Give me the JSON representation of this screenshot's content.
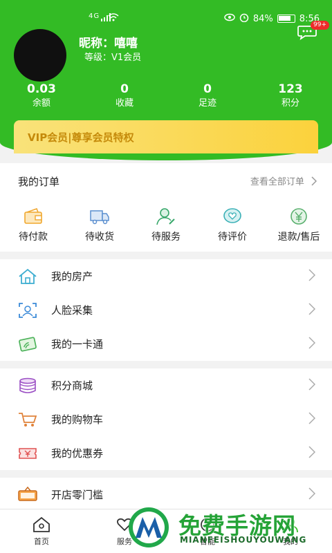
{
  "status_bar": {
    "network": "4G",
    "battery": "84%",
    "time": "8:56"
  },
  "profile": {
    "nickname": "昵称：嘻嘻",
    "level": "等级：V1会员",
    "message_badge": "99+"
  },
  "stats": [
    {
      "value": "0.03",
      "label": "余额"
    },
    {
      "value": "0",
      "label": "收藏"
    },
    {
      "value": "0",
      "label": "足迹"
    },
    {
      "value": "123",
      "label": "积分"
    }
  ],
  "vip_banner": "VIP会员|尊享会员特权",
  "orders": {
    "title": "我的订单",
    "view_all": "查看全部订单",
    "items": [
      {
        "label": "待付款",
        "icon": "wallet-icon"
      },
      {
        "label": "待收货",
        "icon": "truck-icon"
      },
      {
        "label": "待服务",
        "icon": "service-person-icon"
      },
      {
        "label": "待评价",
        "icon": "heart-chat-icon"
      },
      {
        "label": "退款/售后",
        "icon": "yen-refund-icon"
      }
    ]
  },
  "menu_group_1": [
    {
      "label": "我的房产",
      "icon": "house-icon"
    },
    {
      "label": "人脸采集",
      "icon": "face-scan-icon"
    },
    {
      "label": "我的一卡通",
      "icon": "card-icon"
    }
  ],
  "menu_group_2": [
    {
      "label": "积分商城",
      "icon": "coins-stack-icon"
    },
    {
      "label": "我的购物车",
      "icon": "cart-icon"
    },
    {
      "label": "我的优惠券",
      "icon": "coupon-icon"
    }
  ],
  "menu_group_3": [
    {
      "label": "开店零门槛",
      "icon": "open-sign-icon"
    }
  ],
  "tabbar": [
    {
      "label": "首页",
      "icon": "home-icon"
    },
    {
      "label": "服务",
      "icon": "heart-hand-icon"
    },
    {
      "label": "智能",
      "icon": "smart-icon"
    },
    {
      "label": "我的",
      "icon": "user-icon"
    }
  ],
  "watermark": {
    "title": "免费手游网",
    "subtitle": "MIANFEISHOUYOUWANG"
  },
  "colors": {
    "brand_green": "#33bb25",
    "vip_gold": "#fbd23c",
    "badge_red": "#ee2b2b"
  }
}
